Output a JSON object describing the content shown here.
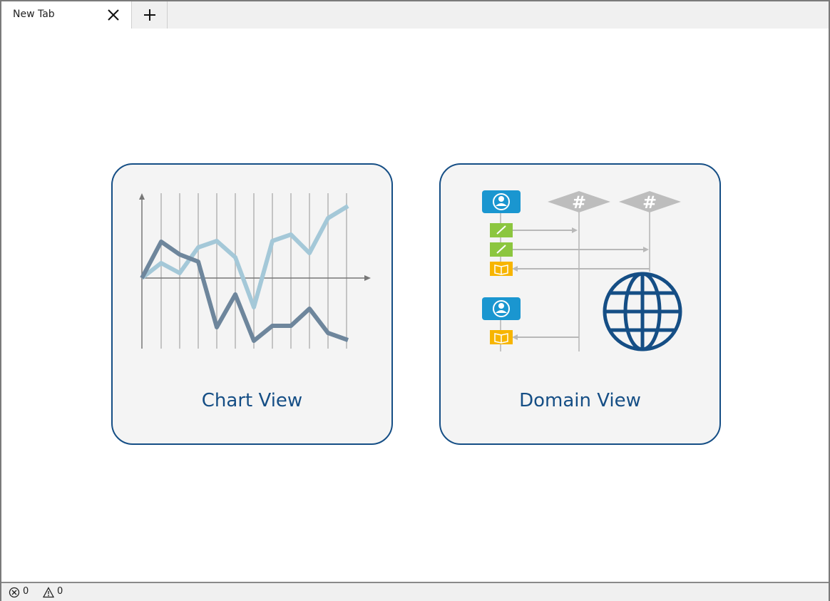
{
  "tabs": [
    {
      "label": "New Tab"
    }
  ],
  "cards": [
    {
      "label": "Chart View"
    },
    {
      "label": "Domain View"
    }
  ],
  "status": {
    "errors": "0",
    "warnings": "0"
  },
  "icons": {
    "tab_close": "close-icon",
    "new_tab": "plus-icon",
    "errors": "error-circle-icon",
    "warnings": "warning-triangle-icon"
  },
  "colors": {
    "accent": "#154e85",
    "card_background": "#f4f4f4",
    "chart_series_dark": "#6e869c",
    "chart_series_light": "#a4c8d8",
    "person_badge": "#1a96d0",
    "edit_badge": "#8cc63f",
    "book_badge": "#f7b500",
    "hash_badge": "#bdbdbd"
  }
}
